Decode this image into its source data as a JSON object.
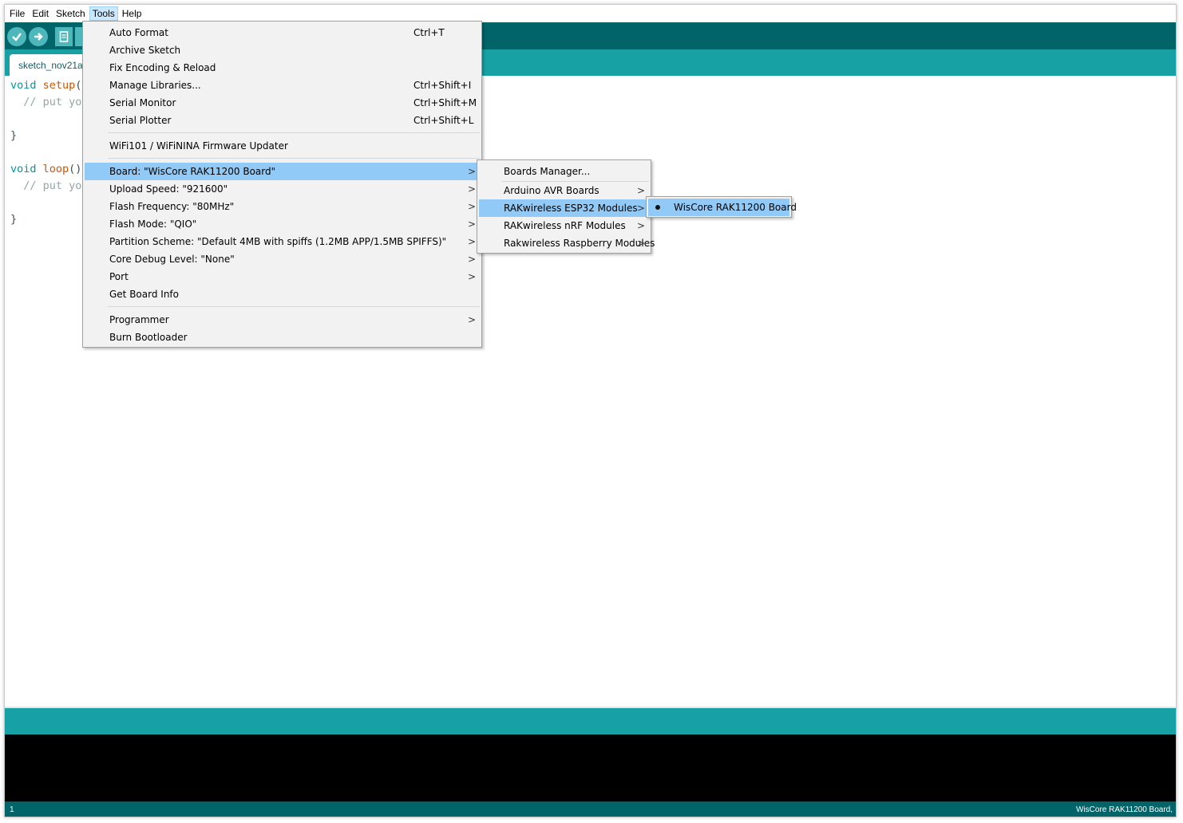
{
  "menubar": {
    "items": [
      {
        "label": "File"
      },
      {
        "label": "Edit"
      },
      {
        "label": "Sketch"
      },
      {
        "label": "Tools",
        "open": true
      },
      {
        "label": "Help"
      }
    ]
  },
  "toolbar": {
    "buttons": [
      {
        "name": "verify",
        "icon": "checkmark-icon"
      },
      {
        "name": "upload",
        "icon": "arrow-right-icon"
      },
      {
        "name": "new",
        "icon": "new-file-icon"
      }
    ]
  },
  "tab": {
    "label": "sketch_nov21a"
  },
  "code": {
    "lines": [
      {
        "kw": "void ",
        "fn": "setup",
        "rest": "() {"
      },
      {
        "comment": "  // put your setup code here, to run once:"
      },
      {
        "plain": ""
      },
      {
        "plain": "}"
      },
      {
        "plain": ""
      },
      {
        "kw": "void ",
        "fn": "loop",
        "rest": "() {"
      },
      {
        "comment": "  // put your main code here, to run repeatedly:"
      },
      {
        "plain": ""
      },
      {
        "plain": "}"
      }
    ]
  },
  "tools_menu": {
    "items": [
      {
        "label": "Auto Format",
        "shortcut": "Ctrl+T"
      },
      {
        "label": "Archive Sketch"
      },
      {
        "label": "Fix Encoding & Reload"
      },
      {
        "label": "Manage Libraries...",
        "shortcut": "Ctrl+Shift+I"
      },
      {
        "label": "Serial Monitor",
        "shortcut": "Ctrl+Shift+M"
      },
      {
        "label": "Serial Plotter",
        "shortcut": "Ctrl+Shift+L"
      },
      {
        "label": "WiFi101 / WiFiNINA Firmware Updater"
      },
      {
        "label": "Board: \"WisCore RAK11200 Board\"",
        "submenu": true,
        "highlighted": true
      },
      {
        "label": "Upload Speed: \"921600\"",
        "submenu": true
      },
      {
        "label": "Flash Frequency: \"80MHz\"",
        "submenu": true
      },
      {
        "label": "Flash Mode: \"QIO\"",
        "submenu": true
      },
      {
        "label": "Partition Scheme: \"Default 4MB with spiffs (1.2MB APP/1.5MB SPIFFS)\"",
        "submenu": true
      },
      {
        "label": "Core Debug Level: \"None\"",
        "submenu": true
      },
      {
        "label": "Port",
        "submenu": true
      },
      {
        "label": "Get Board Info"
      },
      {
        "label": "Programmer",
        "submenu": true
      },
      {
        "label": "Burn Bootloader"
      }
    ]
  },
  "board_menu": {
    "items": [
      {
        "label": "Boards Manager..."
      },
      {
        "label": "Arduino AVR Boards",
        "submenu": true
      },
      {
        "label": "RAKwireless ESP32 Modules",
        "submenu": true,
        "highlighted": true
      },
      {
        "label": "RAKwireless nRF Modules",
        "submenu": true
      },
      {
        "label": "Rakwireless Raspberry Modules",
        "submenu": true
      }
    ]
  },
  "esp32_menu": {
    "items": [
      {
        "label": "WisCore RAK11200 Board",
        "selected": true,
        "highlighted": true
      }
    ]
  },
  "submenu_arrow": ">",
  "status": {
    "line": "1",
    "board": "WisCore RAK11200 Board,"
  },
  "colors": {
    "toolbar": "#006468",
    "tabbar": "#17a1a5",
    "menu_highlight": "#91c9f7",
    "console": "#000000"
  }
}
